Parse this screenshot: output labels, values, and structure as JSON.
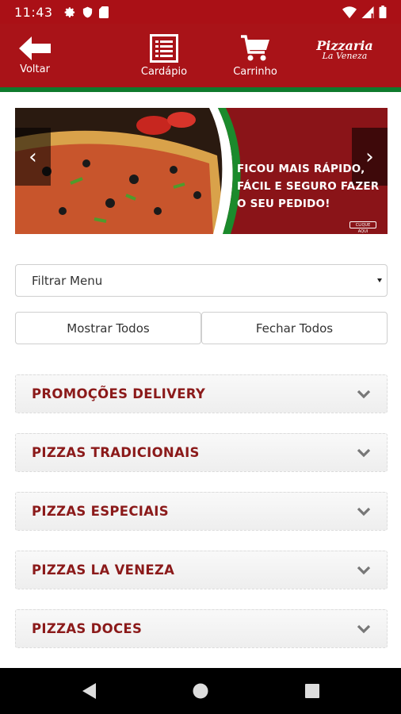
{
  "status_bar": {
    "time": "11:43",
    "left_icons": [
      "gear-icon",
      "shield-icon",
      "sim-card-icon"
    ],
    "right_icons": [
      "wifi-icon",
      "signal-icon",
      "battery-icon"
    ]
  },
  "toolbar": {
    "back_label": "Voltar",
    "menu_label": "Cardápio",
    "cart_label": "Carrinho",
    "logo_main": "Pizzaria",
    "logo_sub": "La Veneza"
  },
  "colors": {
    "brand_red": "#a91318",
    "accent_green": "#0f7a2d",
    "category_text": "#8b1a1a"
  },
  "banner": {
    "text": "FICOU MAIS RÁPIDO, FÁCIL E SEGURO FAZER O SEU PEDIDO!",
    "button_text": "CLIQUE AQUI"
  },
  "filter": {
    "selected": "Filtrar Menu"
  },
  "buttons": {
    "show_all": "Mostrar Todos",
    "close_all": "Fechar Todos"
  },
  "categories": [
    {
      "label": "PROMOÇÕES DELIVERY"
    },
    {
      "label": "PIZZAS TRADICIONAIS"
    },
    {
      "label": "PIZZAS ESPECIAIS"
    },
    {
      "label": "PIZZAS LA VENEZA"
    },
    {
      "label": "PIZZAS DOCES"
    }
  ],
  "nav": [
    "back-icon",
    "home-icon",
    "recents-icon"
  ]
}
